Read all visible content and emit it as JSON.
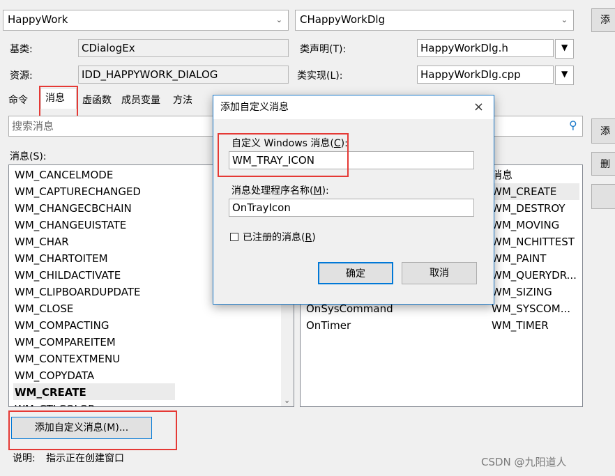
{
  "top": {
    "project_combo": "HappyWork",
    "class_combo": "CHappyWorkDlg",
    "base_class_label": "基类:",
    "base_class_value": "CDialogEx",
    "class_decl_label": "类声明(T):",
    "class_decl_value": "HappyWorkDlg.h",
    "resource_label": "资源:",
    "resource_value": "IDD_HAPPYWORK_DIALOG",
    "class_impl_label": "类实现(L):",
    "class_impl_value": "HappyWorkDlg.cpp",
    "right_button_partial": "添"
  },
  "tabs": [
    {
      "label": "命令"
    },
    {
      "label": "消息"
    },
    {
      "label": "虚函数"
    },
    {
      "label": "成员变量"
    },
    {
      "label": "方法"
    }
  ],
  "search": {
    "placeholder": "搜索消息"
  },
  "messages_label": "消息(S):",
  "messages": [
    "WM_CANCELMODE",
    "WM_CAPTURECHANGED",
    "WM_CHANGECBCHAIN",
    "WM_CHANGEUISTATE",
    "WM_CHAR",
    "WM_CHARTOITEM",
    "WM_CHILDACTIVATE",
    "WM_CLIPBOARDUPDATE",
    "WM_CLOSE",
    "WM_COMPACTING",
    "WM_COMPAREITEM",
    "WM_CONTEXTMENU",
    "WM_COPYDATA",
    "WM_CREATE",
    "WM_CTLCOLOR"
  ],
  "selected_message": "WM_CREATE",
  "handlers": {
    "header_right": "消息",
    "rows": [
      {
        "handler": "",
        "message": "WM_CREATE"
      },
      {
        "handler": "",
        "message": "WM_DESTROY"
      },
      {
        "handler": "",
        "message": "WM_MOVING"
      },
      {
        "handler": "",
        "message": "WM_NCHITTEST"
      },
      {
        "handler": "",
        "message": "WM_PAINT"
      },
      {
        "handler": "",
        "message": "WM_QUERYDR..."
      },
      {
        "handler": "",
        "message": "WM_SIZING"
      },
      {
        "handler": "OnSysCommand",
        "message": "WM_SYSCOM..."
      },
      {
        "handler": "OnTimer",
        "message": "WM_TIMER"
      }
    ]
  },
  "right_buttons": [
    "添",
    "删",
    ""
  ],
  "add_custom_button": "添加自定义消息(M)...",
  "description_label": "说明:",
  "description_text": "指示正在创建窗口",
  "dialog": {
    "title": "添加自定义消息",
    "close": "×",
    "custom_msg_label_prefix": "自定义 Windows 消息(",
    "custom_msg_label_key": "C",
    "custom_msg_label_suffix": "):",
    "custom_msg_value": "WM_TRAY_ICON",
    "handler_label_prefix": "消息处理程序名称(",
    "handler_label_key": "M",
    "handler_label_suffix": "):",
    "handler_value": "OnTrayIcon",
    "registered_prefix": "已注册的消息(",
    "registered_key": "R",
    "registered_suffix": ")",
    "registered_checked": false,
    "ok": "确定",
    "cancel": "取消"
  },
  "watermark": "CSDN @九阳道人",
  "accent_color": "#1979ca",
  "highlight_color": "#e53935"
}
